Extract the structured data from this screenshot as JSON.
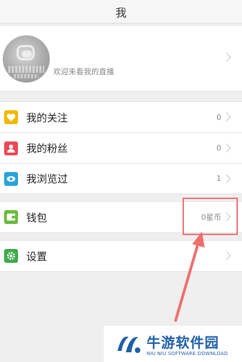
{
  "header": {
    "title": "我"
  },
  "profile": {
    "welcome_text": "欢迎来看我的直播"
  },
  "menu": {
    "following": {
      "label": "我的关注",
      "count": "0"
    },
    "fans": {
      "label": "我的粉丝",
      "count": "0"
    },
    "browsed": {
      "label": "我浏览过",
      "count": "1"
    },
    "wallet": {
      "label": "钱包",
      "value": "0星币"
    },
    "settings": {
      "label": "设置"
    }
  },
  "icons": {
    "following": "heart-icon",
    "fans": "user-icon",
    "browsed": "eye-icon",
    "wallet": "wallet-icon",
    "settings": "gear-icon"
  },
  "colors": {
    "following_icon": "#f2b800",
    "fans_icon": "#e94b55",
    "browsed_icon": "#2aa3dd",
    "wallet_icon": "#6bbd3c",
    "settings_icon": "#3eaa4a",
    "annotation": "#ef6f6f"
  },
  "watermark": {
    "name": "牛游软件园",
    "subtitle": "NIU NIU SOFTWARE DOWNLOAD"
  }
}
